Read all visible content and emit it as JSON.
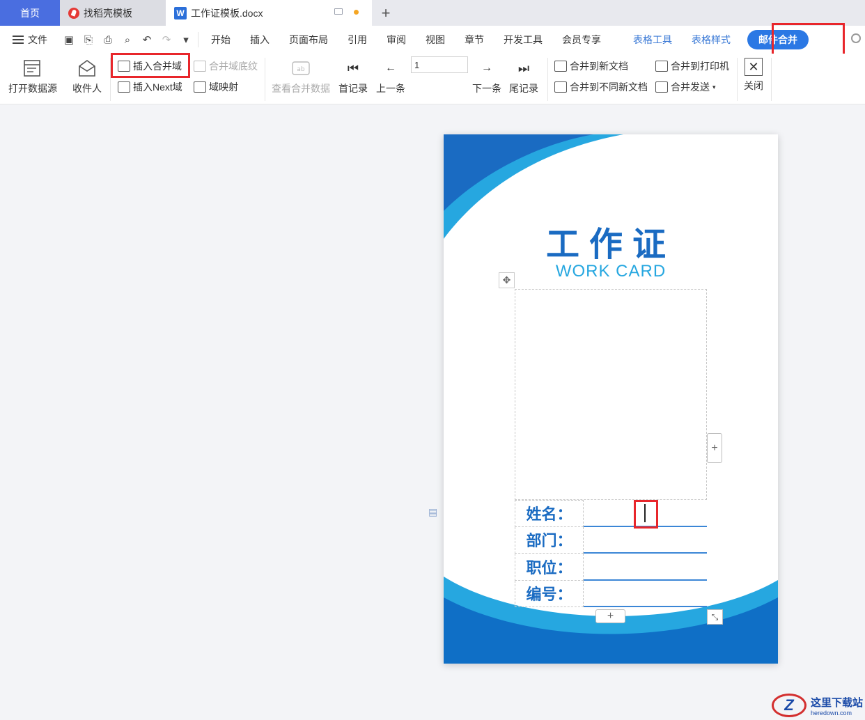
{
  "tabs": {
    "home": "首页",
    "store": "找稻壳模板",
    "doc": "工作证模板.docx"
  },
  "menu": {
    "file": "文件",
    "items": [
      "开始",
      "插入",
      "页面布局",
      "引用",
      "审阅",
      "视图",
      "章节",
      "开发工具",
      "会员专享"
    ],
    "table_tools": "表格工具",
    "table_style": "表格样式",
    "mail_merge": "邮件合并"
  },
  "ribbon": {
    "open_source": "打开数据源",
    "recipients": "收件人",
    "insert_merge_field": "插入合并域",
    "merge_field_shading": "合并域底纹",
    "insert_next": "插入Next域",
    "field_mapping": "域映射",
    "view_merged": "查看合并数据",
    "first_record": "首记录",
    "prev_record": "上一条",
    "record_number": "1",
    "next_record": "下一条",
    "last_record": "尾记录",
    "merge_new_doc": "合并到新文档",
    "merge_diff_docs": "合并到不同新文档",
    "merge_printer": "合并到打印机",
    "merge_send": "合并发送",
    "close": "关闭"
  },
  "card": {
    "title_cn": "工作证",
    "title_en": "WORK CARD",
    "fields": [
      {
        "label": "姓名："
      },
      {
        "label": "部门："
      },
      {
        "label": "职位："
      },
      {
        "label": "编号："
      }
    ]
  },
  "watermark": {
    "cn": "这里下载站",
    "en": "heredown.com"
  },
  "colors": {
    "accent": "#2b78e4",
    "card_blue": "#1a6bc2",
    "card_light": "#26a7e0",
    "highlight": "#e8262b"
  }
}
